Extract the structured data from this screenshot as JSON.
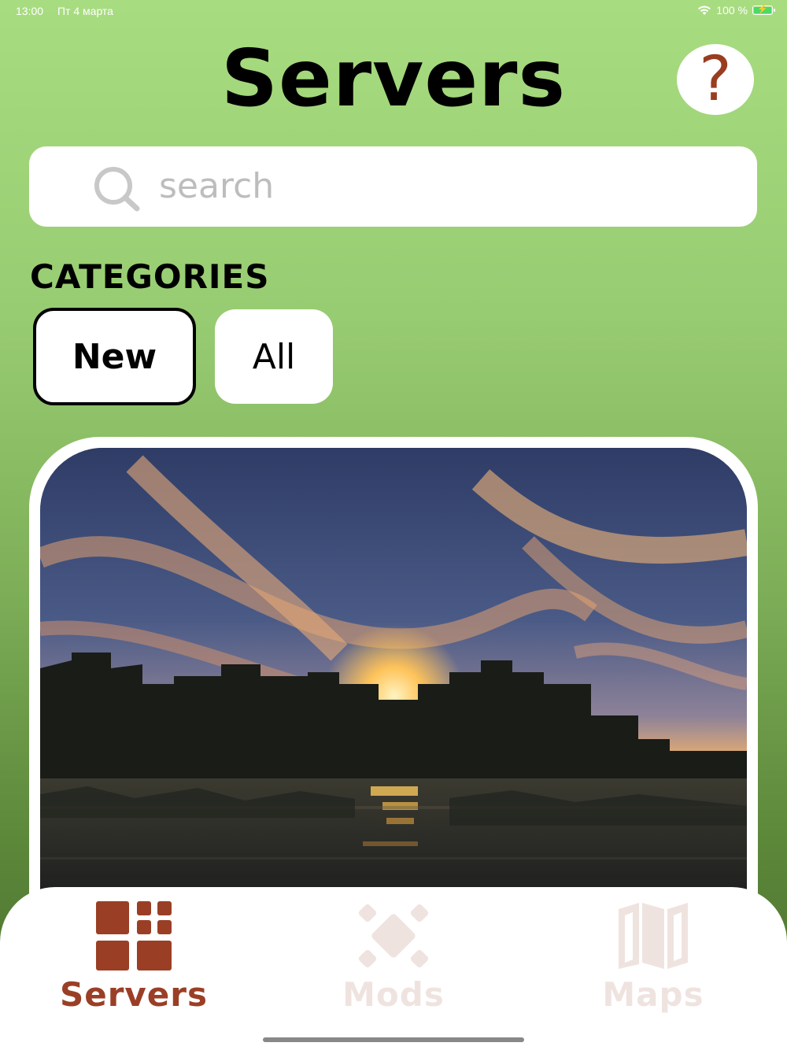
{
  "status_bar": {
    "time": "13:00",
    "date": "Пт 4 марта",
    "battery": "100 %"
  },
  "header": {
    "title": "Servers",
    "help_label": "?"
  },
  "search": {
    "placeholder": "search",
    "value": ""
  },
  "categories": {
    "label": "CATEGORIES",
    "items": [
      {
        "label": "New",
        "selected": true
      },
      {
        "label": "All",
        "selected": false
      }
    ]
  },
  "tabs": [
    {
      "label": "Servers",
      "icon": "grid-icon",
      "active": true
    },
    {
      "label": "Mods",
      "icon": "diamond-cluster-icon",
      "active": false
    },
    {
      "label": "Maps",
      "icon": "map-icon",
      "active": false
    }
  ],
  "colors": {
    "accent": "#9a3f26",
    "inactive_tab": "#efe3e0",
    "background_top": "#a8dc80",
    "background_bottom": "#4a6e2c"
  }
}
